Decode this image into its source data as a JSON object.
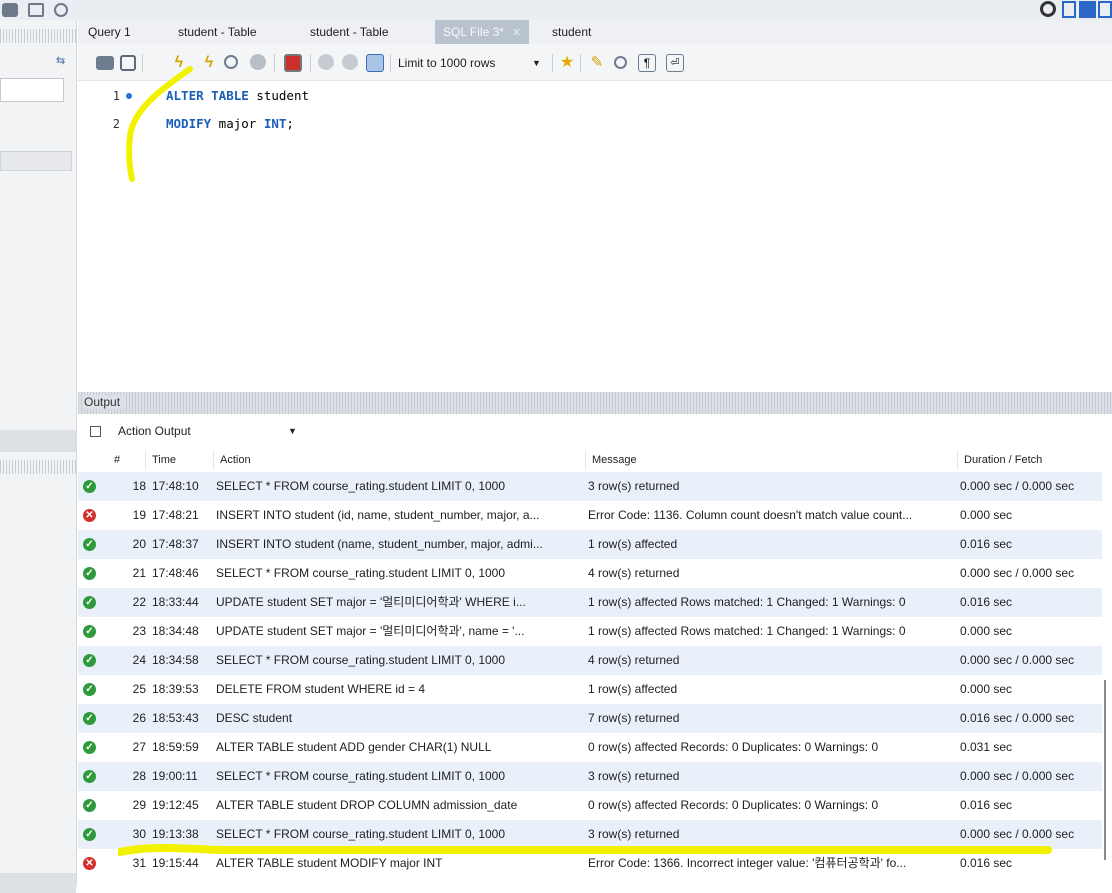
{
  "tabs": [
    {
      "label": "Query 1"
    },
    {
      "label": "student - Table"
    },
    {
      "label": "student - Table"
    },
    {
      "label": "SQL File 3*"
    },
    {
      "label": "student"
    }
  ],
  "toolbar": {
    "limit_label": "Limit to 1000 rows"
  },
  "editor": {
    "lines": [
      {
        "num": "1",
        "kw1": "ALTER TABLE",
        "rest1": " student"
      },
      {
        "num": "2",
        "kw1": "MODIFY",
        "rest1": " major ",
        "kw2": "INT",
        "rest2": ";"
      }
    ]
  },
  "output": {
    "label": "Output",
    "selector": "Action Output",
    "columns": [
      "#",
      "Time",
      "Action",
      "Message",
      "Duration / Fetch"
    ],
    "rows": [
      {
        "status": "ok",
        "num": "18",
        "time": "17:48:10",
        "action": "SELECT * FROM course_rating.student LIMIT 0, 1000",
        "message": "3 row(s) returned",
        "duration": "0.000 sec / 0.000 sec"
      },
      {
        "status": "err",
        "num": "19",
        "time": "17:48:21",
        "action": "INSERT INTO student (id, name, student_number, major, a...",
        "message": "Error Code: 1136. Column count doesn't match value count...",
        "duration": "0.000 sec"
      },
      {
        "status": "ok",
        "num": "20",
        "time": "17:48:37",
        "action": "INSERT INTO student (name, student_number, major, admi...",
        "message": "1 row(s) affected",
        "duration": "0.016 sec"
      },
      {
        "status": "ok",
        "num": "21",
        "time": "17:48:46",
        "action": "SELECT * FROM course_rating.student LIMIT 0, 1000",
        "message": "4 row(s) returned",
        "duration": "0.000 sec / 0.000 sec"
      },
      {
        "status": "ok",
        "num": "22",
        "time": "18:33:44",
        "action": "UPDATE student SET major = '멀티미디어학과' WHERE i...",
        "message": "1 row(s) affected Rows matched: 1  Changed: 1  Warnings: 0",
        "duration": "0.016 sec"
      },
      {
        "status": "ok",
        "num": "23",
        "time": "18:34:48",
        "action": "UPDATE student  SET major = '멀티미디어학과', name = '...",
        "message": "1 row(s) affected Rows matched: 1  Changed: 1  Warnings: 0",
        "duration": "0.000 sec"
      },
      {
        "status": "ok",
        "num": "24",
        "time": "18:34:58",
        "action": "SELECT * FROM course_rating.student LIMIT 0, 1000",
        "message": "4 row(s) returned",
        "duration": "0.000 sec / 0.000 sec"
      },
      {
        "status": "ok",
        "num": "25",
        "time": "18:39:53",
        "action": "DELETE FROM student WHERE id = 4",
        "message": "1 row(s) affected",
        "duration": "0.000 sec"
      },
      {
        "status": "ok",
        "num": "26",
        "time": "18:53:43",
        "action": "DESC student",
        "message": "7 row(s) returned",
        "duration": "0.016 sec / 0.000 sec"
      },
      {
        "status": "ok",
        "num": "27",
        "time": "18:59:59",
        "action": "ALTER TABLE student ADD gender CHAR(1) NULL",
        "message": "0 row(s) affected Records: 0  Duplicates: 0  Warnings: 0",
        "duration": "0.031 sec"
      },
      {
        "status": "ok",
        "num": "28",
        "time": "19:00:11",
        "action": "SELECT * FROM course_rating.student LIMIT 0, 1000",
        "message": "3 row(s) returned",
        "duration": "0.000 sec / 0.000 sec"
      },
      {
        "status": "ok",
        "num": "29",
        "time": "19:12:45",
        "action": "ALTER TABLE student  DROP COLUMN admission_date",
        "message": "0 row(s) affected Records: 0  Duplicates: 0  Warnings: 0",
        "duration": "0.016 sec"
      },
      {
        "status": "ok",
        "num": "30",
        "time": "19:13:38",
        "action": "SELECT * FROM course_rating.student LIMIT 0, 1000",
        "message": "3 row(s) returned",
        "duration": "0.000 sec / 0.000 sec"
      },
      {
        "status": "err",
        "num": "31",
        "time": "19:15:44",
        "action": "ALTER TABLE student MODIFY major INT",
        "message": "Error Code: 1366. Incorrect integer value: '컴퓨터공학과' fo...",
        "duration": "0.016 sec"
      }
    ]
  },
  "colors": {
    "highlight": "#f2f200",
    "ok": "#2e9a3c",
    "error": "#d42f2f",
    "alt_row": "#e9f0fa",
    "keyword": "#1c5fb9"
  }
}
